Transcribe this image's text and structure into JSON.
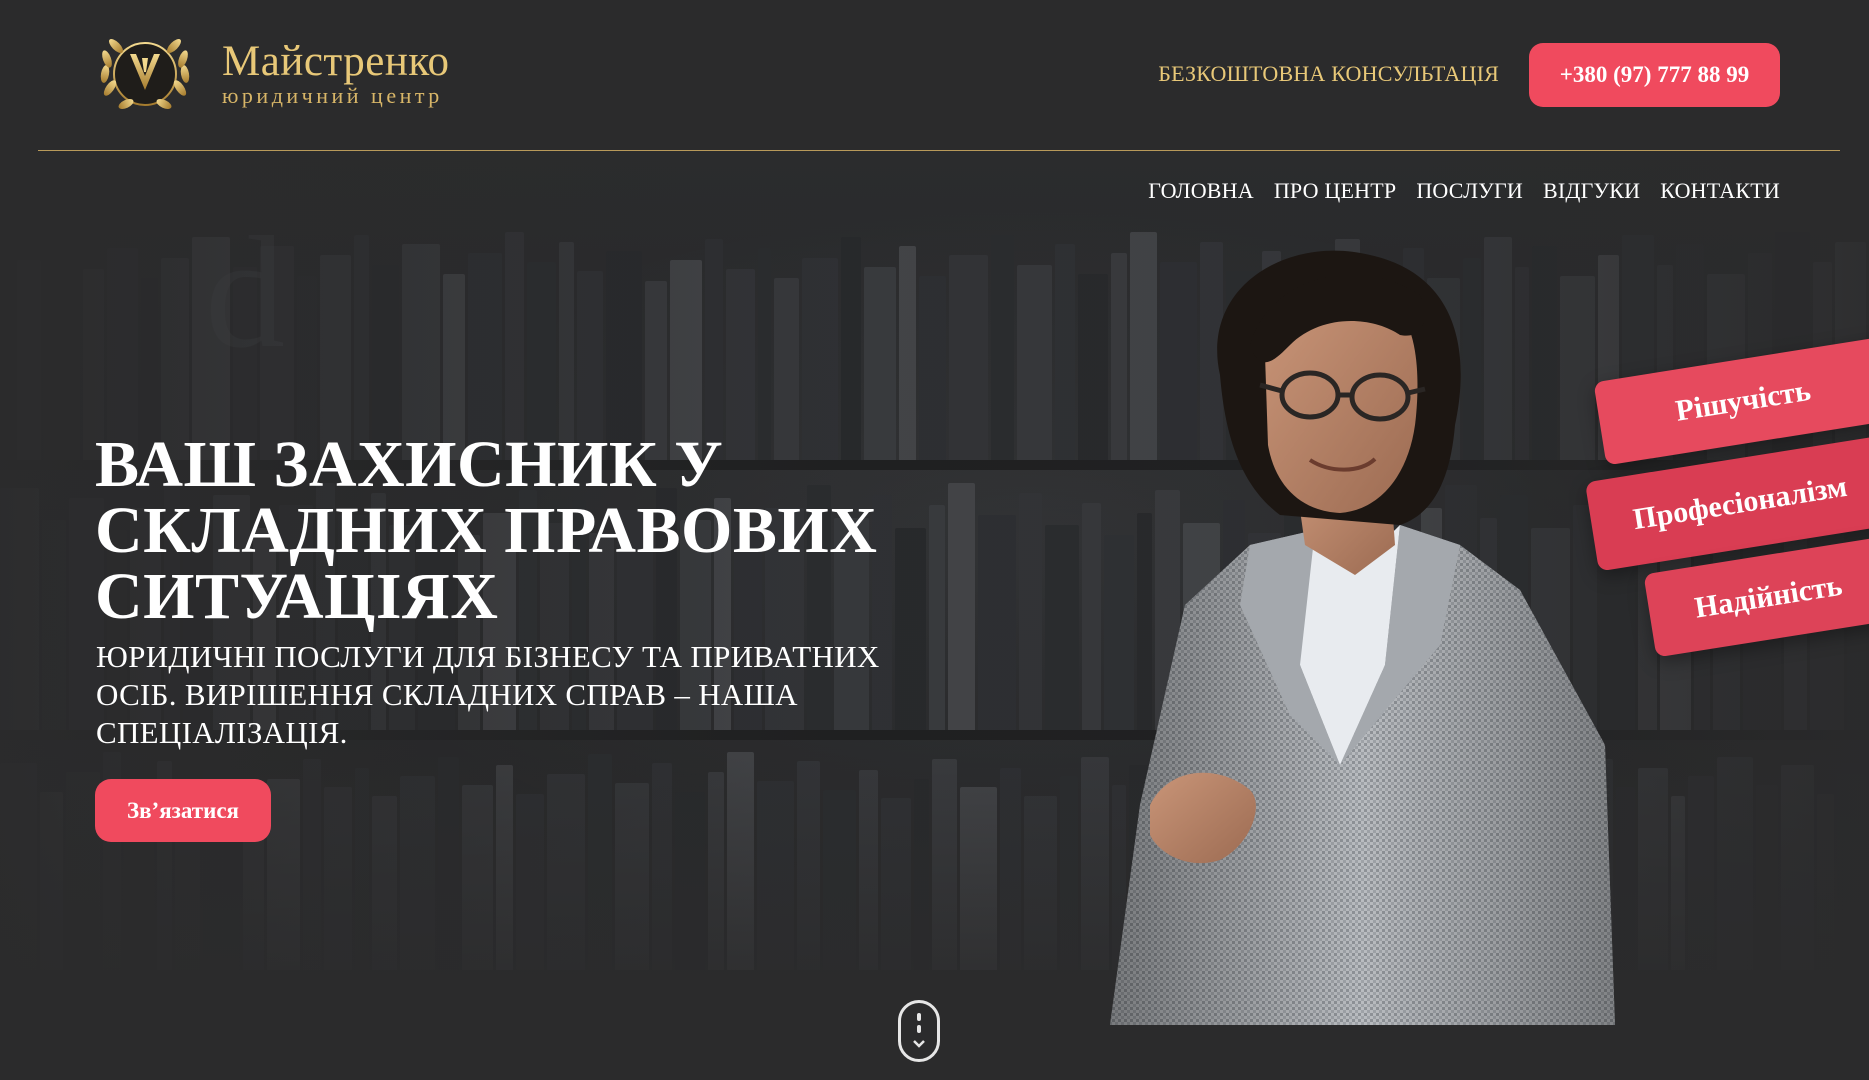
{
  "brand": {
    "title": "Майстренко",
    "subtitle": "юридичний центр"
  },
  "header": {
    "consultation_label": "БЕЗКОШТОВНА КОНСУЛЬТАЦІЯ",
    "phone_label": "+380 (97) 777 88 99"
  },
  "nav": {
    "items": [
      {
        "label": "ГОЛОВНА"
      },
      {
        "label": "ПРО ЦЕНТР"
      },
      {
        "label": "ПОСЛУГИ"
      },
      {
        "label": "ВІДГУКИ"
      },
      {
        "label": "КОНТАКТИ"
      }
    ]
  },
  "hero": {
    "title": "ВАШ ЗАХИСНИК У СКЛАДНИХ ПРАВОВИХ СИТУАЦІЯХ",
    "subtitle": "ЮРИДИЧНІ ПОСЛУГИ ДЛЯ БІЗНЕСУ ТА ПРИВАТНИХ ОСІБ. ВИРІШЕННЯ СКЛАДНИХ СПРАВ – НАША СПЕЦІАЛІЗАЦІЯ.",
    "cta_label": "Зв’язатися"
  },
  "values": {
    "items": [
      {
        "label": "Рішучість"
      },
      {
        "label": "Професіоналізм"
      },
      {
        "label": "Надійність"
      }
    ]
  },
  "colors": {
    "accent": "#f04a5e",
    "gold": "#e8c878",
    "background": "#2b2b2c"
  },
  "icons": {
    "logo": "laurel-wreath-emblem-icon",
    "scroll": "scroll-mouse-icon"
  }
}
